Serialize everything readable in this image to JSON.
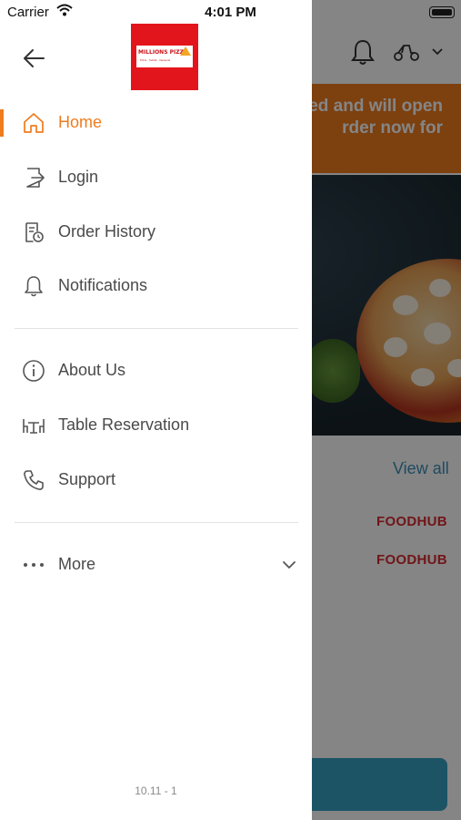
{
  "status_bar": {
    "carrier": "Carrier",
    "time": "4:01 PM"
  },
  "background": {
    "banner_line1": "ed and will open",
    "banner_line2": "rder now for",
    "view_all": "View all",
    "brand_1": "FOODHUB",
    "brand_2": "FOODHUB"
  },
  "drawer": {
    "logo_text": "MILLIONS PIZZA",
    "logo_subtext": "Pizza · Kebab · Desserts",
    "menu_primary": [
      {
        "label": "Home",
        "icon": "home-icon",
        "active": true
      },
      {
        "label": "Login",
        "icon": "login-icon",
        "active": false
      },
      {
        "label": "Order History",
        "icon": "order-history-icon",
        "active": false
      },
      {
        "label": "Notifications",
        "icon": "bell-icon",
        "active": false
      }
    ],
    "menu_secondary": [
      {
        "label": "About Us",
        "icon": "info-icon"
      },
      {
        "label": "Table Reservation",
        "icon": "table-icon"
      },
      {
        "label": "Support",
        "icon": "phone-icon"
      }
    ],
    "more": {
      "label": "More",
      "icon": "more-dots-icon"
    },
    "version": "10.11 - 1"
  },
  "colors": {
    "accent": "#ef7c1e",
    "text": "#4a4a4a",
    "brand_red": "#e3151c",
    "link_blue": "#3d8fb8"
  }
}
